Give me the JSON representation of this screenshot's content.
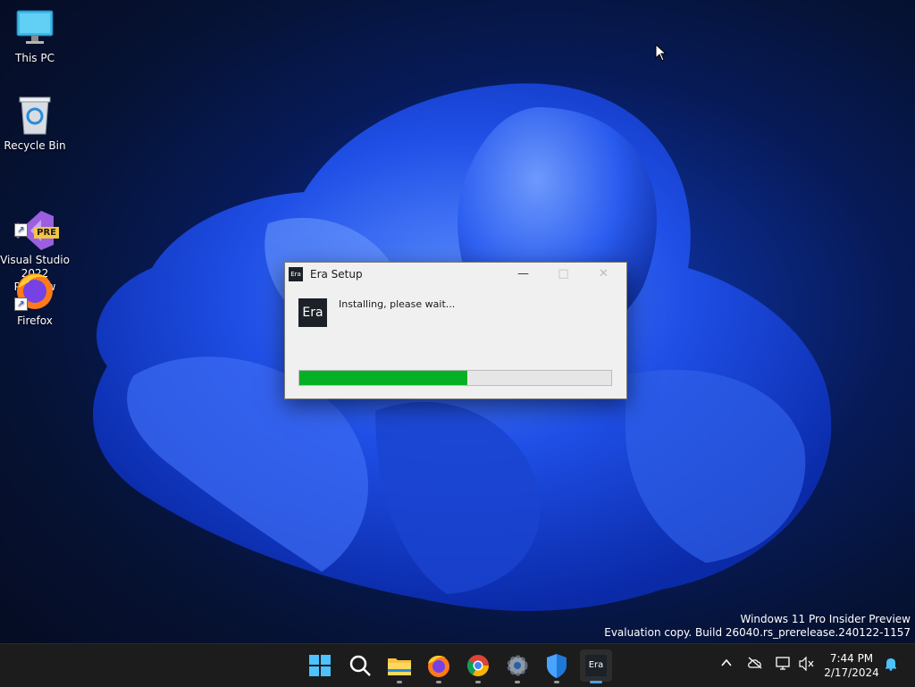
{
  "desktop": {
    "icons": [
      {
        "label": "This PC",
        "icon": "monitor-icon"
      },
      {
        "label": "Recycle Bin",
        "icon": "recycle-bin-icon"
      },
      {
        "label": "Visual Studio\n2022 Preview",
        "icon": "visual-studio-preview-icon",
        "badge": "PRE"
      },
      {
        "label": "Firefox",
        "icon": "firefox-icon"
      }
    ]
  },
  "window": {
    "title": "Era Setup",
    "app_badge": "Era",
    "logo_text": "Era",
    "status": "Installing, please wait...",
    "progress_fraction": 0.54,
    "colors": {
      "progress": "#06b025"
    }
  },
  "watermark": {
    "line1": "Windows 11 Pro Insider Preview",
    "line2": "Evaluation copy. Build 26040.rs_prerelease.240122-1157"
  },
  "taskbar": {
    "pinned": [
      "start-icon",
      "search-icon",
      "file-explorer-icon",
      "firefox-icon",
      "chrome-icon",
      "settings-icon",
      "windows-security-icon",
      "era-icon"
    ],
    "era_label": "Era",
    "tray": [
      "chevron-up-icon",
      "onedrive-offline-icon",
      "network-icon",
      "volume-muted-icon",
      "notification-bell-icon"
    ],
    "time": "7:44 PM",
    "date": "2/17/2024"
  }
}
